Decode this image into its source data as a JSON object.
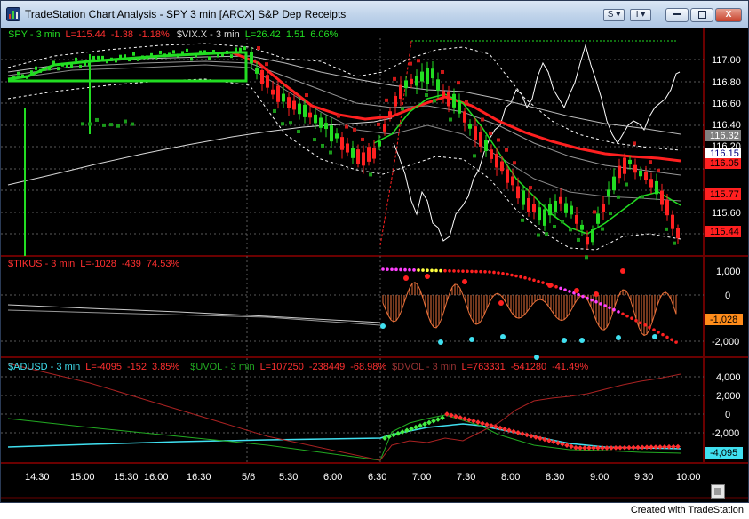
{
  "window": {
    "title": "TradeStation Chart Analysis - SPY 3 min [ARCX] S&P Dep Receipts",
    "buttons": {
      "style_menu": "S",
      "indicator_menu": "I",
      "minimize": "",
      "maximize": "",
      "close": "X"
    }
  },
  "footer": "Created with TradeStation",
  "colors": {
    "background": "#000000",
    "spy": "#00cc00",
    "red": "#ff2020",
    "cyan": "#40e0f0",
    "yellow": "#ffff40",
    "orange": "#ff8c1a"
  },
  "panes": {
    "price": {
      "legend": [
        {
          "text": "SPY - 3 min",
          "color": "#22dd22"
        },
        {
          "text": "L=115.44",
          "color": "#ff3030"
        },
        {
          "text": "-1.38",
          "color": "#ff3030"
        },
        {
          "text": "-1.18%",
          "color": "#ff3030"
        },
        {
          "text": "$VIX.X - 3 min",
          "color": "#dddddd"
        },
        {
          "text": "L=26.42",
          "color": "#22dd22"
        },
        {
          "text": "1.51",
          "color": "#22dd22"
        },
        {
          "text": "6.06%",
          "color": "#22dd22"
        }
      ],
      "ticks": [
        "117.00",
        "116.80",
        "116.60",
        "116.40",
        "116.20",
        "115.60"
      ],
      "markers": [
        {
          "text": "116.32",
          "bg": "#808080",
          "fg": "#ffffff"
        },
        {
          "text": "116.15",
          "bg": "#ffffff",
          "fg": "#000080"
        },
        {
          "text": "116.05",
          "bg": "#ff2020",
          "fg": "#000000"
        },
        {
          "text": "115.77",
          "bg": "#ff2020",
          "fg": "#000000"
        },
        {
          "text": "115.44",
          "bg": "#ff2020",
          "fg": "#000000"
        }
      ]
    },
    "tikus": {
      "legend": [
        {
          "text": "$TIKUS - 3 min",
          "color": "#ff3030"
        },
        {
          "text": "L=-1028",
          "color": "#ff3030"
        },
        {
          "text": "-439",
          "color": "#ff3030"
        },
        {
          "text": "74.53%",
          "color": "#ff3030"
        }
      ],
      "ticks": [
        "1,000",
        "0",
        "-2,000"
      ],
      "marker": {
        "text": "-1,028",
        "bg": "#ff8c1a",
        "fg": "#000000"
      }
    },
    "adusd": {
      "legend": [
        {
          "text": "$ADUSD - 3 min",
          "color": "#40e0f0"
        },
        {
          "text": "L=-4095",
          "color": "#ff3030"
        },
        {
          "text": "-152",
          "color": "#ff3030"
        },
        {
          "text": "3.85%",
          "color": "#ff3030"
        },
        {
          "text": "$UVOL - 3 min",
          "color": "#22aa22"
        },
        {
          "text": "L=107250",
          "color": "#ff3030"
        },
        {
          "text": "-238449",
          "color": "#ff3030"
        },
        {
          "text": "-68.98%",
          "color": "#ff3030"
        },
        {
          "text": "$DVOL - 3 min",
          "color": "#993333"
        },
        {
          "text": "L=763331",
          "color": "#ff3030"
        },
        {
          "text": "-541280",
          "color": "#ff3030"
        },
        {
          "text": "-41.49%",
          "color": "#ff3030"
        }
      ],
      "ticks": [
        "4,000",
        "2,000",
        "0",
        "-2,000"
      ],
      "marker": {
        "text": "-4,095",
        "bg": "#40e0f0",
        "fg": "#000000"
      }
    }
  },
  "time_axis": [
    "14:30",
    "15:00",
    "15:30",
    "16:00",
    "16:30",
    "5/6",
    "5:30",
    "6:00",
    "6:30",
    "7:00",
    "7:30",
    "8:00",
    "8:30",
    "9:00",
    "9:30",
    "10:00"
  ]
}
